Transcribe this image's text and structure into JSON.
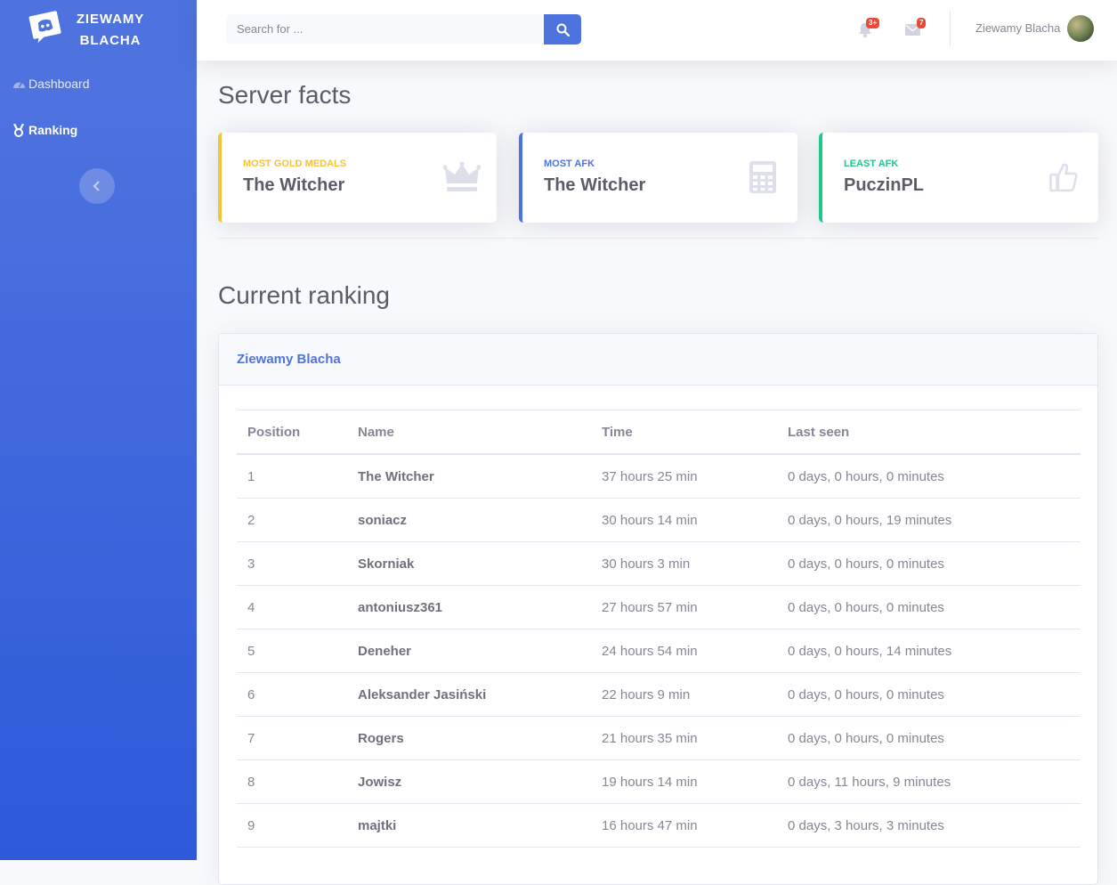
{
  "brand": {
    "line1": "ZIEWAMY",
    "line2": "BLACHA",
    "logo_icon": "discord-icon"
  },
  "sidebar": {
    "items": [
      {
        "label": "Dashboard",
        "icon": "tachometer-icon",
        "active": false
      },
      {
        "label": "Ranking",
        "icon": "medal-icon",
        "active": true
      }
    ],
    "toggle_icon": "chevron-left-icon"
  },
  "topbar": {
    "search_placeholder": "Search for ...",
    "search_icon": "search-icon",
    "alerts_badge": "3+",
    "messages_badge": "7",
    "username": "Ziewamy Blacha"
  },
  "facts": {
    "heading": "Server facts",
    "cards": [
      {
        "label": "Most gold medals",
        "value": "The Witcher",
        "icon": "crown-icon",
        "color": "#f6c23e"
      },
      {
        "label": "Most AFK",
        "value": "The Witcher",
        "icon": "calculator-icon",
        "color": "#4e73df"
      },
      {
        "label": "Least AFK",
        "value": "PuczinPL",
        "icon": "thumbs-up-icon",
        "color": "#1cc88a"
      }
    ]
  },
  "ranking": {
    "heading": "Current ranking",
    "panel_title": "Ziewamy Blacha",
    "columns": [
      "Position",
      "Name",
      "Time",
      "Last seen"
    ],
    "rows": [
      [
        "1",
        "The Witcher",
        "37 hours 25 min",
        "0 days, 0 hours, 0 minutes"
      ],
      [
        "2",
        "soniacz",
        "30 hours 14 min",
        "0 days, 0 hours, 19 minutes"
      ],
      [
        "3",
        "Skorniak",
        "30 hours 3 min",
        "0 days, 0 hours, 0 minutes"
      ],
      [
        "4",
        "antoniusz361",
        "27 hours 57 min",
        "0 days, 0 hours, 0 minutes"
      ],
      [
        "5",
        "Deneher",
        "24 hours 54 min",
        "0 days, 0 hours, 14 minutes"
      ],
      [
        "6",
        "Aleksander Jasiński",
        "22 hours 9 min",
        "0 days, 0 hours, 0 minutes"
      ],
      [
        "7",
        "Rogers",
        "21 hours 35 min",
        "0 days, 0 hours, 0 minutes"
      ],
      [
        "8",
        "Jowisz",
        "19 hours 14 min",
        "0 days, 11 hours, 9 minutes"
      ],
      [
        "9",
        "majtki",
        "16 hours 47 min",
        "0 days, 3 hours, 3 minutes"
      ]
    ]
  }
}
